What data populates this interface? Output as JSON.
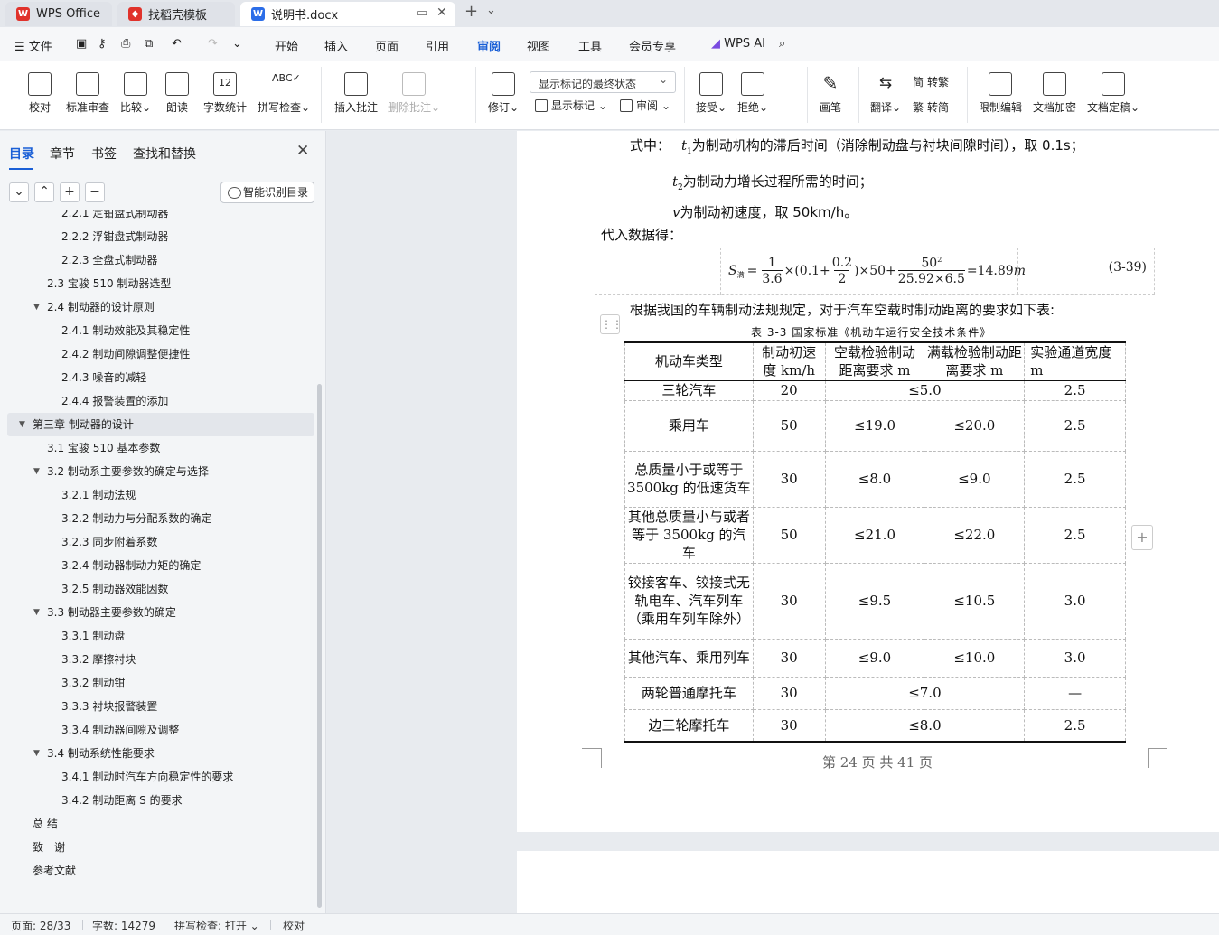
{
  "tabs": {
    "wps": "WPS Office",
    "template": "找稻壳模板",
    "doc": "说明书.docx"
  },
  "menu": {
    "file": "文件",
    "items": [
      "开始",
      "插入",
      "页面",
      "引用",
      "审阅",
      "视图",
      "工具",
      "会员专享"
    ],
    "ai": "WPS AI"
  },
  "ribbon": {
    "proof": "校对",
    "std_review": "标准审查",
    "compare": "比较",
    "read_aloud": "朗读",
    "word_count": "字数统计",
    "spell_check": "拼写检查",
    "insert_comment": "插入批注",
    "delete_comment": "删除批注",
    "track": "修订",
    "display_state": "显示标记的最终状态",
    "show_markup": "显示标记",
    "review": "审阅",
    "accept": "接受",
    "reject": "拒绝",
    "pen": "画笔",
    "translate": "翻译",
    "to_trad": "转繁",
    "to_simp": "转简",
    "restrict": "限制编辑",
    "encrypt": "文档加密",
    "finalize": "文档定稿",
    "wordcount_icon": "12"
  },
  "sidebar": {
    "tabs": [
      "目录",
      "章节",
      "书签",
      "查找和替换"
    ],
    "smart_toc": "智能识别目录",
    "toc": [
      {
        "label": "2.2.1 定钳盘式制动器",
        "level": 3
      },
      {
        "label": "2.2.2 浮钳盘式制动器",
        "level": 3
      },
      {
        "label": "2.2.3 全盘式制动器",
        "level": 3
      },
      {
        "label": "2.3 宝骏 510 制动器选型",
        "level": 2
      },
      {
        "label": "2.4 制动器的设计原则",
        "level": 2,
        "caret": true
      },
      {
        "label": "2.4.1 制动效能及其稳定性",
        "level": 3
      },
      {
        "label": "2.4.2 制动间隙调整便捷性",
        "level": 3
      },
      {
        "label": "2.4.3 噪音的减轻",
        "level": 3
      },
      {
        "label": "2.4.4 报警装置的添加",
        "level": 3
      },
      {
        "label": "第三章 制动器的设计",
        "level": 1,
        "caret": true,
        "selected": true
      },
      {
        "label": "3.1 宝骏 510 基本参数",
        "level": 2
      },
      {
        "label": "3.2 制动系主要参数的确定与选择",
        "level": 2,
        "caret": true
      },
      {
        "label": "3.2.1 制动法规",
        "level": 3
      },
      {
        "label": "3.2.2 制动力与分配系数的确定",
        "level": 3
      },
      {
        "label": "3.2.3 同步附着系数",
        "level": 3
      },
      {
        "label": "3.2.4 制动器制动力矩的确定",
        "level": 3
      },
      {
        "label": "3.2.5 制动器效能因数",
        "level": 3
      },
      {
        "label": "3.3 制动器主要参数的确定",
        "level": 2,
        "caret": true
      },
      {
        "label": "3.3.1 制动盘",
        "level": 3
      },
      {
        "label": "3.3.2 摩擦衬块",
        "level": 3
      },
      {
        "label": "3.3.2 制动钳",
        "level": 3
      },
      {
        "label": "3.3.3 衬块报警装置",
        "level": 3
      },
      {
        "label": "3.3.4 制动器间隙及调整",
        "level": 3
      },
      {
        "label": "3.4 制动系统性能要求",
        "level": 2,
        "caret": true
      },
      {
        "label": "3.4.1 制动时汽车方向稳定性的要求",
        "level": 3
      },
      {
        "label": "3.4.2 制动距离 S 的要求",
        "level": 3
      },
      {
        "label": "总 结",
        "level": 1
      },
      {
        "label": "致　谢",
        "level": 1
      },
      {
        "label": "参考文献",
        "level": 1
      }
    ]
  },
  "doc": {
    "line1_pre": "式中：",
    "line1_var": "t",
    "line1_sub": "1",
    "line1_text": "为制动机构的滞后时间（消除制动盘与衬块间隙时间），取 0.1s；",
    "line2_var": "t",
    "line2_sub": "2",
    "line2_text": "为制动力增长过程所需的时间；",
    "line3_var": "v",
    "line3_text": "为制动初速度，取 50km/h。",
    "line4": "代入数据得：",
    "eq_s": "S",
    "eq_sub": "满",
    "eq_n1": "1",
    "eq_d1": "3.6",
    "eq_mid1": "×(0.1+",
    "eq_n2": "0.2",
    "eq_d2": "2",
    "eq_mid2": ")×50+",
    "eq_n3": "50",
    "eq_sup": "2",
    "eq_d3": "25.92×6.5",
    "eq_res": "=14.89",
    "eq_unit": "m",
    "eq_num": "(3-39)",
    "para": "根据我国的车辆制动法规规定，对于汽车空载时制动距离的要求如下表:",
    "caption": "表 3-3 国家标准《机动车运行安全技术条件》",
    "table_headers": [
      "机动车类型",
      "制动初速度 km/h",
      "空载检验制动距离要求 m",
      "满载检验制动距离要求 m",
      "实验通道宽度 m"
    ],
    "rows": [
      {
        "type": "三轮汽车",
        "speed": "20",
        "merged": "≤5.0",
        "width": "2.5"
      },
      {
        "type": "乘用车",
        "speed": "50",
        "empty": "≤19.0",
        "full": "≤20.0",
        "width": "2.5"
      },
      {
        "type": "总质量小于或等于 3500kg 的低速货车",
        "speed": "30",
        "empty": "≤8.0",
        "full": "≤9.0",
        "width": "2.5"
      },
      {
        "type": "其他总质量小与或者等于 3500kg 的汽车",
        "speed": "50",
        "empty": "≤21.0",
        "full": "≤22.0",
        "width": "2.5"
      },
      {
        "type": "铰接客车、铰接式无轨电车、汽车列车（乘用车列车除外）",
        "speed": "30",
        "empty": "≤9.5",
        "full": "≤10.5",
        "width": "3.0"
      },
      {
        "type": "其他汽车、乘用列车",
        "speed": "30",
        "empty": "≤9.0",
        "full": "≤10.0",
        "width": "3.0"
      },
      {
        "type": "两轮普通摩托车",
        "speed": "30",
        "merged": "≤7.0",
        "width": "—"
      },
      {
        "type": "边三轮摩托车",
        "speed": "30",
        "merged": "≤8.0",
        "width": "2.5"
      }
    ],
    "footer": "第 24 页 共 41 页"
  },
  "status": {
    "page": "页面: 28/33",
    "words": "字数: 14279",
    "spell": "拼写检查: 打开",
    "proof": "校对"
  },
  "colors": {
    "accent": "#1a5fd6",
    "wps_red": "#e0322b",
    "template_red": "#e0322b",
    "doc_blue": "#2b6de8"
  }
}
